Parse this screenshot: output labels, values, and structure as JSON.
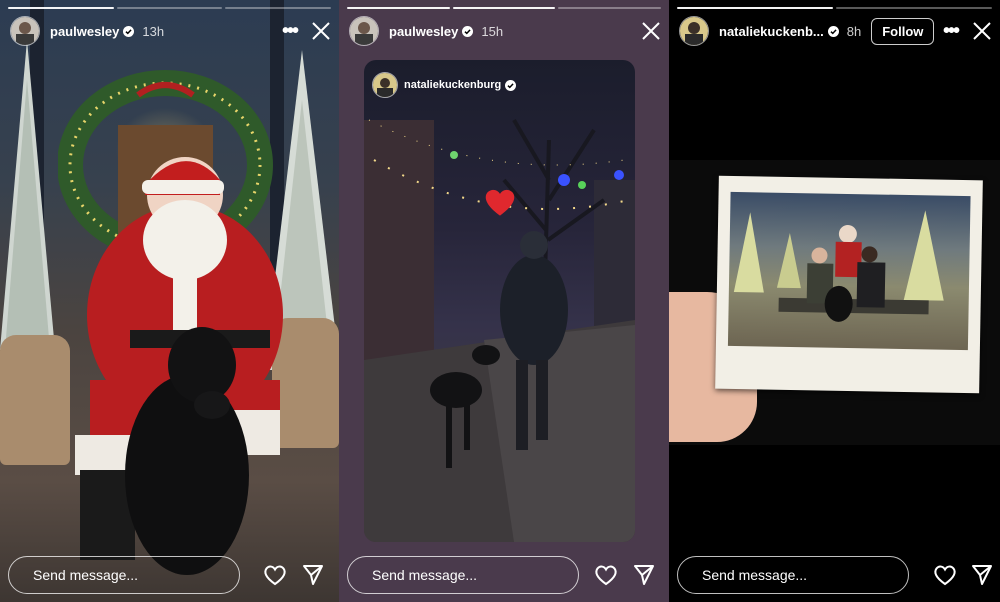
{
  "stories": [
    {
      "username": "paulwesley",
      "verified": true,
      "time": "13h",
      "more_label": "•••",
      "progress": {
        "total": 3,
        "completed": 1
      },
      "message_placeholder": "Send message...",
      "icons": {
        "more": "more-icon",
        "close": "close-icon",
        "like": "heart-icon",
        "share": "send-icon"
      }
    },
    {
      "username": "paulwesley",
      "verified": true,
      "time": "15h",
      "more_label": "",
      "progress": {
        "total": 3,
        "completed": 2
      },
      "message_placeholder": "Send message...",
      "reshared_from": {
        "username": "nataliekuckenburg",
        "verified": true
      },
      "sticker": "heart-emoji",
      "icons": {
        "close": "close-icon",
        "like": "heart-icon",
        "share": "send-icon"
      }
    },
    {
      "username": "nataliekuckenb...",
      "verified": true,
      "time": "8h",
      "follow_label": "Follow",
      "more_label": "•••",
      "progress": {
        "total": 2,
        "completed": 1
      },
      "message_placeholder": "Send message...",
      "icons": {
        "more": "more-icon",
        "close": "close-icon",
        "like": "heart-icon",
        "share": "send-icon"
      }
    }
  ],
  "colors": {
    "verified": "#3897f0",
    "panel2_bg": "#4a3a4c",
    "text": "#ffffff"
  }
}
